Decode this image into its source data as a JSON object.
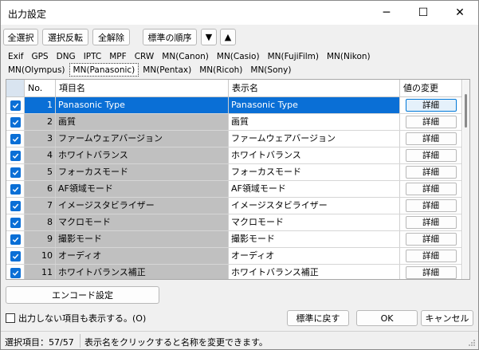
{
  "window": {
    "title": "出力設定",
    "min_glyph": "─",
    "max_glyph": "☐",
    "close_glyph": "✕"
  },
  "toolbar": {
    "select_all": "全選択",
    "invert_selection": "選択反転",
    "deselect_all": "全解除",
    "standard_order": "標準の順序",
    "move_down_glyph": "▼",
    "move_up_glyph": "▲"
  },
  "tabs_row1": [
    "Exif",
    "GPS",
    "DNG",
    "IPTC",
    "MPF",
    "CRW",
    "MN(Canon)",
    "MN(Casio)",
    "MN(FujiFilm)",
    "MN(Nikon)"
  ],
  "tabs_row2": [
    "MN(Olympus)",
    "MN(Panasonic)",
    "MN(Pentax)",
    "MN(Ricoh)",
    "MN(Sony)"
  ],
  "active_tab": "MN(Panasonic)",
  "grid": {
    "headers": {
      "no": "No.",
      "item": "項目名",
      "display": "表示名",
      "value": "値の変更"
    },
    "detail_label": "詳細",
    "rows": [
      {
        "no": "1",
        "item": "Panasonic Type",
        "display": "Panasonic Type",
        "checked": true,
        "selected": true
      },
      {
        "no": "2",
        "item": "画質",
        "display": "画質",
        "checked": true
      },
      {
        "no": "3",
        "item": "ファームウェアバージョン",
        "display": "ファームウェアバージョン",
        "checked": true
      },
      {
        "no": "4",
        "item": "ホワイトバランス",
        "display": "ホワイトバランス",
        "checked": true
      },
      {
        "no": "5",
        "item": "フォーカスモード",
        "display": "フォーカスモード",
        "checked": true
      },
      {
        "no": "6",
        "item": "AF領域モード",
        "display": "AF領域モード",
        "checked": true
      },
      {
        "no": "7",
        "item": "イメージスタビライザー",
        "display": "イメージスタビライザー",
        "checked": true
      },
      {
        "no": "8",
        "item": "マクロモード",
        "display": "マクロモード",
        "checked": true
      },
      {
        "no": "9",
        "item": "撮影モード",
        "display": "撮影モード",
        "checked": true
      },
      {
        "no": "10",
        "item": "オーディオ",
        "display": "オーディオ",
        "checked": true
      },
      {
        "no": "11",
        "item": "ホワイトバランス補正",
        "display": "ホワイトバランス補正",
        "checked": true
      }
    ]
  },
  "encode_button": "エンコード設定",
  "show_hidden_label": "出力しない項目も表示する。(O)",
  "show_hidden_checked": false,
  "buttons": {
    "reset": "標準に戻す",
    "ok": "OK",
    "cancel": "キャンセル"
  },
  "status": {
    "selected_items": "選択項目：57/57",
    "hint": "表示名をクリックすると名称を変更できます。"
  },
  "colors": {
    "selection": "#0a6fd6",
    "check_accent": "#0a6fd6",
    "item_col_bg": "#c0c0c0"
  }
}
